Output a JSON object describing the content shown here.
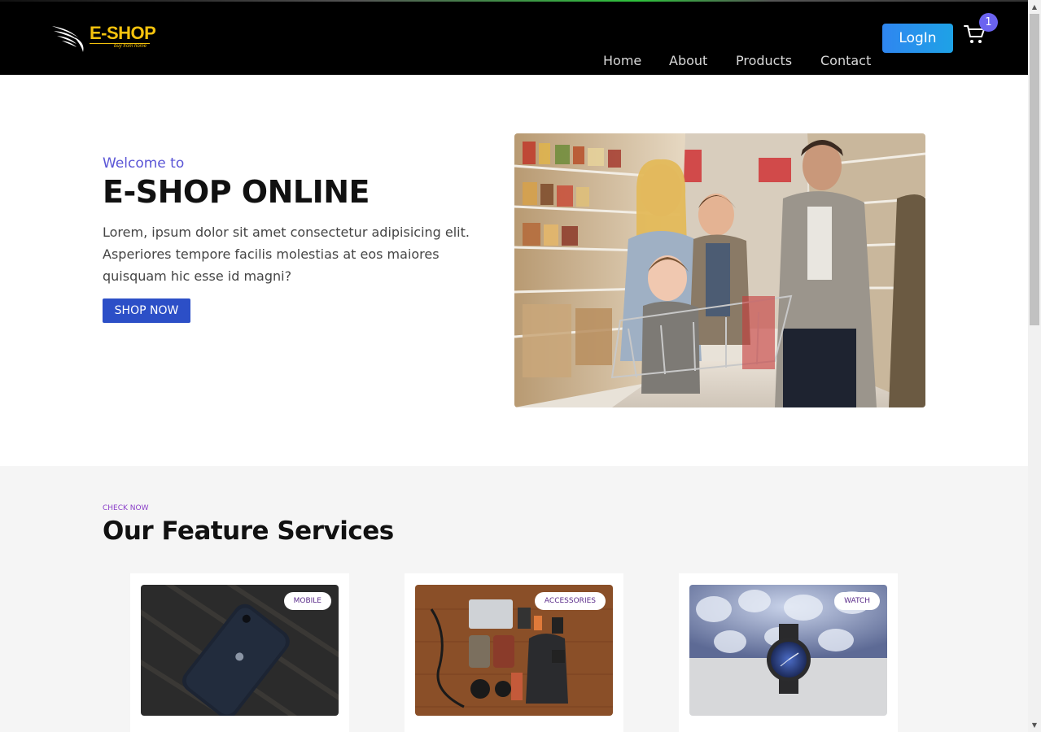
{
  "brand": {
    "name": "E-SHOP",
    "tagline": "buy from home",
    "color": "#f4c20d"
  },
  "nav": {
    "links": [
      "Home",
      "About",
      "Products",
      "Contact"
    ],
    "login_label": "LogIn",
    "cart_count": "1",
    "cart_icon": "cart-icon"
  },
  "hero": {
    "welcome": "Welcome to",
    "title": "E-SHOP ONLINE",
    "description": "Lorem, ipsum dolor sit amet consectetur adipisicing elit. Asperiores tempore facilis molestias at eos maiores quisquam hic esse id magni?",
    "cta_label": "SHOP NOW",
    "accent_color": "#2c4fc7"
  },
  "services": {
    "eyebrow": "CHECK NOW",
    "title": "Our Feature Services",
    "cards": [
      {
        "tag": "MOBILE"
      },
      {
        "tag": "ACCESSORIES"
      },
      {
        "tag": "WATCH"
      }
    ]
  }
}
